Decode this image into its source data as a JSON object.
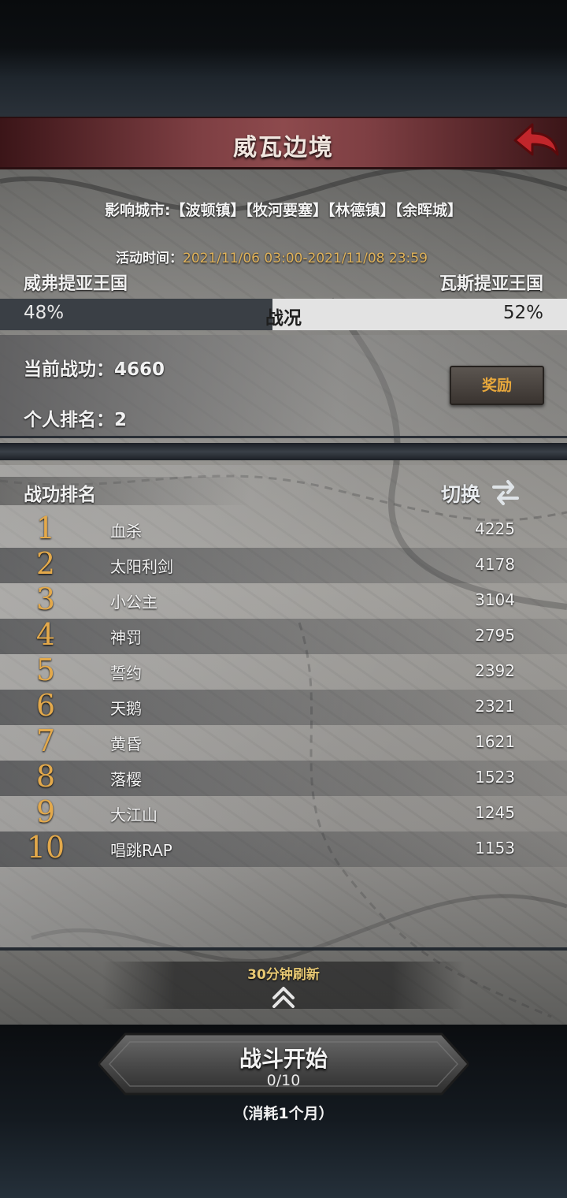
{
  "header": {
    "title": "威瓦边境"
  },
  "event": {
    "cities_label": "影响城市:【波顿镇】【牧河要塞】【林德镇】【余晖城】",
    "time_label": "活动时间：",
    "time_value": "2021/11/06 03:00-2021/11/08 23:59"
  },
  "war": {
    "left_nation": "威弗提亚王国",
    "right_nation": "瓦斯提亚王国",
    "left_percent": "48%",
    "right_percent": "52%",
    "left_share": 0.48,
    "center_label": "战况"
  },
  "stats": {
    "merit": "当前战功：4660",
    "rank": "个人排名：2",
    "reward_label": "奖励"
  },
  "ranking": {
    "title": "战功排名",
    "switch_label": "切换",
    "rows": [
      {
        "rank": "1",
        "name": "血杀",
        "score": "4225"
      },
      {
        "rank": "2",
        "name": "太阳利剑",
        "score": "4178"
      },
      {
        "rank": "3",
        "name": "小公主",
        "score": "3104"
      },
      {
        "rank": "4",
        "name": "神罚",
        "score": "2795"
      },
      {
        "rank": "5",
        "name": "誓约",
        "score": "2392"
      },
      {
        "rank": "6",
        "name": "天鹅",
        "score": "2321"
      },
      {
        "rank": "7",
        "name": "黄昏",
        "score": "1621"
      },
      {
        "rank": "8",
        "name": "落樱",
        "score": "1523"
      },
      {
        "rank": "9",
        "name": "大江山",
        "score": "1245"
      },
      {
        "rank": "10",
        "name": "唱跳RAP",
        "score": "1153"
      }
    ]
  },
  "footer": {
    "refresh_note": "30分钟刷新",
    "battle_label": "战斗开始",
    "battle_count": "0/10",
    "cost_note": "（消耗1个月）"
  },
  "colors": {
    "accent_gold": "#e3a94b",
    "header_red": "#8d4a4d",
    "time_value": "#e1b35a"
  }
}
